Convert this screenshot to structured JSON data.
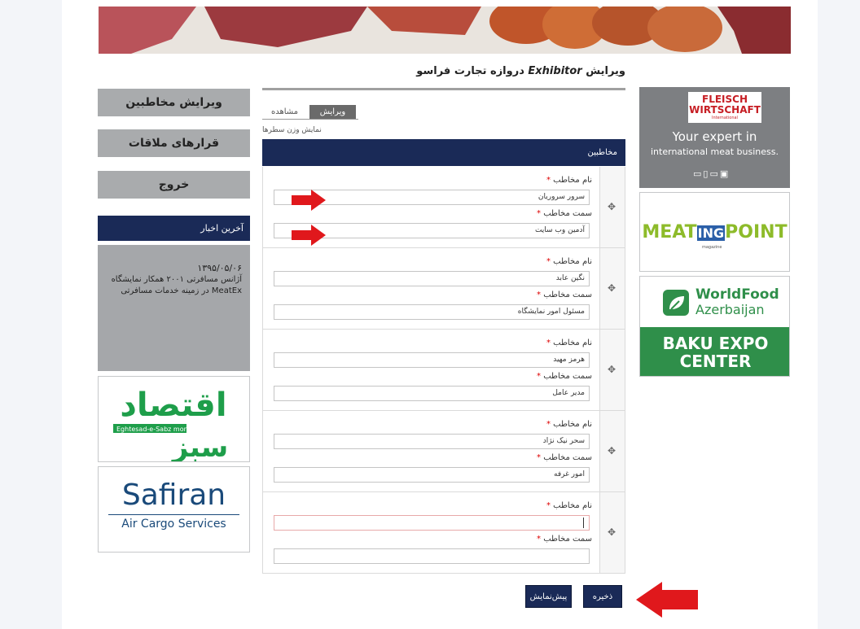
{
  "header": {
    "title_prefix": "ویرایش",
    "title_en": "Exhibitor",
    "title_suffix": "دروازه تجارت فراسو"
  },
  "left_menu": {
    "edit_contacts": "ویرایش مخاطبین",
    "meetings": "قرارهای ملاقات",
    "logout": "خروج"
  },
  "news": {
    "heading": "آخرین اخبار",
    "date": "۱۳۹۵/۰۵/۰۶",
    "text": "آژانس مسافرتی ۲۰۰۱ همکار نمایشگاه MeatEx در زمینه خدمات مسافرتی"
  },
  "left_ads": {
    "eghtesad_fa": "اقتصاد",
    "eghtesad_fa2": "سبز",
    "eghtesad_en": "Eghtesad-e-Sabz monthly",
    "safiran_title": "Safiran",
    "safiran_sub": "Air Cargo Services"
  },
  "right_ads": {
    "fleisch_1": "FLEISCH",
    "fleisch_2": "WIRTSCHAFT",
    "fleisch_3": "International",
    "fleisch_tag1": "Your expert in",
    "fleisch_tag2": "international meat business.",
    "meat_a": "MEAT",
    "meat_b": "ING",
    "meat_c": "POINT",
    "meat_sub": "magazine",
    "wf_1": "WorldFood",
    "wf_2": "Azerbaijan",
    "baku_1": "BAKU EXPO",
    "baku_2": "CENTER"
  },
  "tabs": {
    "edit": "ویرایش",
    "view": "مشاهده"
  },
  "weight_link": "نمایش وزن سطرها",
  "grid": {
    "heading": "مخاطبین",
    "name_label": "نام مخاطب",
    "role_label": "سمت مخاطب",
    "required_mark": "*",
    "rows": [
      {
        "name": "سرور سروریان",
        "role": "آدمین وب سایت"
      },
      {
        "name": "نگین عابد",
        "role": "مسئول امور نمایشگاه"
      },
      {
        "name": "هرمز مهید",
        "role": "مدیر عامل"
      },
      {
        "name": "سحر نیک نژاد",
        "role": "امور غرفه"
      },
      {
        "name": "",
        "role": ""
      }
    ]
  },
  "buttons": {
    "save": "ذخیره",
    "preview": "پیش‌نمایش"
  },
  "colors": {
    "navy": "#1a2a57",
    "arrow": "#e0181c",
    "menu_gray": "#a9abad"
  }
}
